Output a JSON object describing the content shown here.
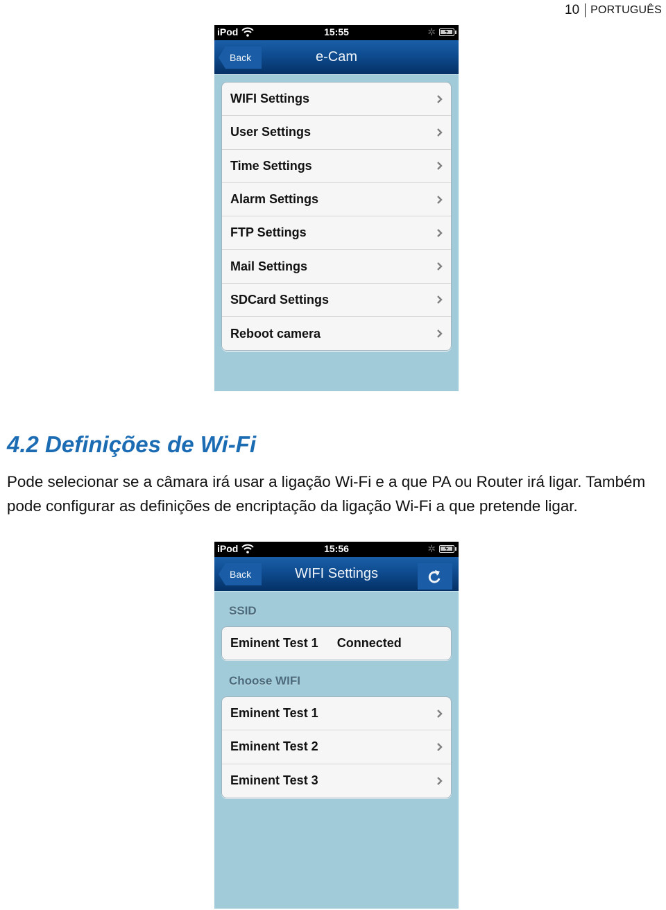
{
  "page_header": {
    "page_number": "10",
    "language": "PORTUGUÊS"
  },
  "screenshot_1": {
    "status_bar": {
      "carrier": "iPod",
      "time": "15:55",
      "icons": [
        "wifi-icon",
        "bluetooth-icon",
        "battery-charging-icon"
      ]
    },
    "nav_bar": {
      "back_label": "Back",
      "title": "e-Cam"
    },
    "menu_items": [
      {
        "label": "WIFI Settings"
      },
      {
        "label": "User Settings"
      },
      {
        "label": "Time Settings"
      },
      {
        "label": "Alarm Settings"
      },
      {
        "label": "FTP Settings"
      },
      {
        "label": "Mail Settings"
      },
      {
        "label": "SDCard Settings"
      },
      {
        "label": "Reboot camera"
      }
    ]
  },
  "section": {
    "heading": "4.2 Definições de Wi-Fi",
    "body": "Pode selecionar se a câmara irá usar a ligação Wi-Fi e a que PA ou Router irá ligar. Também pode configurar as definições de encriptação da ligação Wi-Fi a que pretende ligar."
  },
  "screenshot_2": {
    "status_bar": {
      "carrier": "iPod",
      "time": "15:56",
      "icons": [
        "wifi-icon",
        "bluetooth-icon",
        "battery-charging-icon"
      ]
    },
    "nav_bar": {
      "back_label": "Back",
      "title": "WIFI Settings",
      "refresh_icon": "refresh-icon"
    },
    "ssid_section": {
      "label": "SSID",
      "current_network": "Eminent Test 1",
      "status": "Connected"
    },
    "choose_section": {
      "label": "Choose WIFI",
      "networks": [
        {
          "label": "Eminent Test 1"
        },
        {
          "label": "Eminent Test 2"
        },
        {
          "label": "Eminent Test 3"
        }
      ]
    }
  },
  "colors": {
    "heading_blue": "#1c6cb4",
    "nav_blue": "#0e4b8f",
    "background_blue": "#a1cbd9"
  }
}
